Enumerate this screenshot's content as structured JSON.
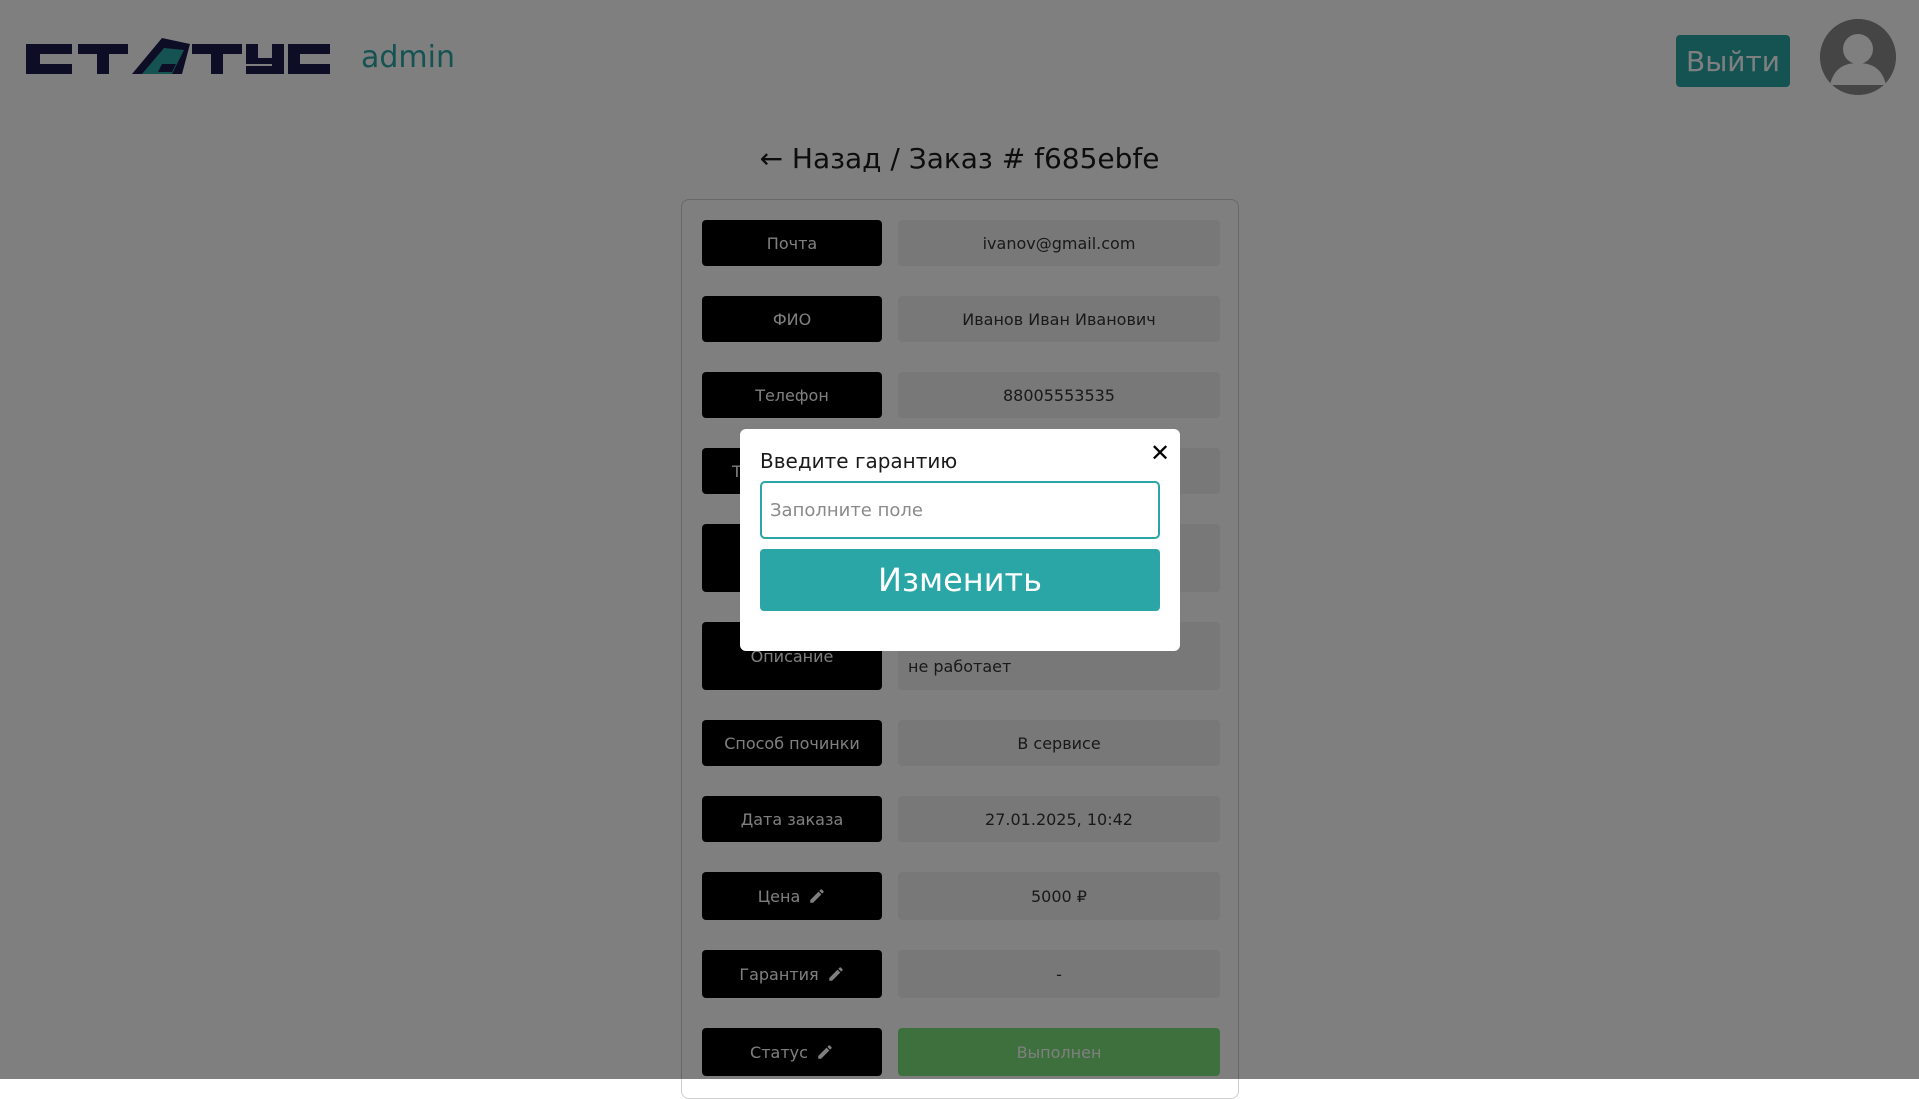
{
  "header": {
    "logo_text": "СТАТУС",
    "role": "admin",
    "logout_label": "Выйти",
    "accent_color": "#2aa6a6",
    "logo_color": "#1a1a4a"
  },
  "title": {
    "back_label": "← Назад",
    "separator": " / ",
    "order_label": "Заказ # f685ebfe"
  },
  "order_fields": [
    {
      "label": "Почта",
      "value": "ivanov@gmail.com"
    },
    {
      "label": "ФИО",
      "value": "Иванов Иван Иванович"
    },
    {
      "label": "Телефон",
      "value": "88005553535"
    },
    {
      "label": "Т",
      "value": ""
    },
    {
      "label": "",
      "value": ""
    },
    {
      "label": "Описание",
      "value": "не работает"
    },
    {
      "label": "Способ починки",
      "value": "В сервисе"
    },
    {
      "label": "Дата заказа",
      "value": "27.01.2025, 10:42"
    },
    {
      "label": "Цена",
      "value": "5000 ₽",
      "editable": true
    },
    {
      "label": "Гарантия",
      "value": "-",
      "editable": true
    },
    {
      "label": "Статус",
      "value": "Выполнен",
      "editable": true,
      "status_color": "#7be07b"
    }
  ],
  "modal": {
    "title": "Введите гарантию",
    "input_placeholder": "Заполните поле",
    "input_value": "",
    "submit_label": "Изменить",
    "close_icon": "close-icon"
  }
}
